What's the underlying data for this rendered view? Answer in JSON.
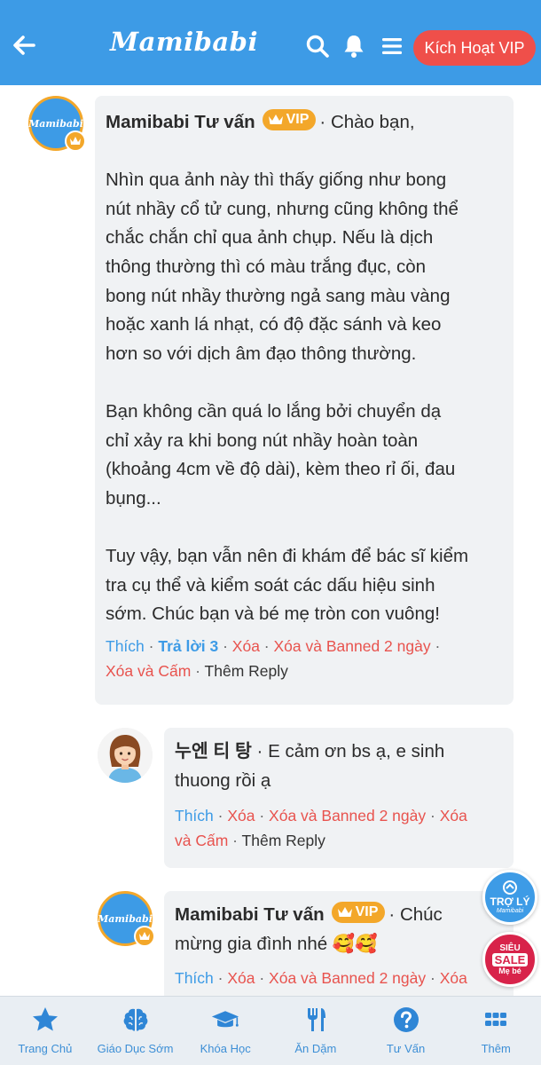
{
  "header": {
    "logo": "Mamibabi",
    "vip_button": "Kích Hoạt VIP",
    "icons": [
      "back-arrow-icon",
      "search-icon",
      "bell-icon",
      "menu-icon"
    ],
    "bg_color": "#3d9be6",
    "vip_color": "#ef4f4a"
  },
  "comments": [
    {
      "author": "Mamibabi Tư vấn",
      "vip_label": "VIP",
      "avatar_text": "Mamibabi",
      "lines": [
        "· Chào bạn,",
        "",
        "Nhìn qua ảnh này thì thấy giống như bong",
        "nút nhầy cổ tử cung, nhưng cũng không thể",
        "chắc chắn chỉ qua ảnh chụp. Nếu là dịch",
        "thông thường thì có màu trắng đục, còn",
        "bong nút nhầy thường ngả sang màu vàng",
        "hoặc xanh lá nhạt, có độ đặc sánh và keo",
        "hơn so với dịch âm đạo thông thường.",
        "",
        "Bạn không cần quá lo lắng bởi chuyển dạ",
        "chỉ xảy ra khi bong nút nhầy hoàn toàn",
        "(khoảng 4cm về độ dài), kèm theo rỉ ối, đau",
        "bụng...",
        "",
        "Tuy vậy, bạn vẫn nên đi khám để bác sĩ kiểm",
        "tra cụ thể và kiểm soát các dấu hiệu sinh",
        "sớm. Chúc bạn và bé mẹ tròn con vuông!"
      ],
      "actions": {
        "like": "Thích",
        "reply": "Trả lời 3",
        "delete": "Xóa",
        "delete_ban": "Xóa và Banned 2 ngày",
        "delete_block": "Xóa và Cấm",
        "more_reply": "Thêm Reply"
      }
    },
    {
      "author": "누엔 티 탕",
      "line1": "· E cảm ơn bs ạ, e sinh",
      "line2": "thuong rồi ạ",
      "actions": {
        "like": "Thích",
        "delete": "Xóa",
        "delete_ban": "Xóa và Banned 2 ngày",
        "delete_block_1": "Xóa",
        "delete_block_2": "và Cấm",
        "more_reply": "Thêm Reply"
      }
    },
    {
      "author": "Mamibabi Tư vấn",
      "vip_label": "VIP",
      "avatar_text": "Mamibabi",
      "line1": "· Chúc",
      "line2": "mừng gia đình nhé 🥰🥰",
      "actions": {
        "like": "Thích",
        "delete": "Xóa",
        "delete_ban": "Xóa và Banned 2 ngày",
        "delete_block": "Xóa"
      }
    }
  ],
  "floating": {
    "assistant_1": "TRỢ LÝ",
    "assistant_2": "Mamibabi",
    "sale_1": "SIÊU",
    "sale_2": "SALE",
    "sale_3": "Mẹ bé"
  },
  "bottom_nav": [
    {
      "label": "Trang Chủ",
      "icon": "star-icon"
    },
    {
      "label": "Giáo Dục Sớm",
      "icon": "brain-icon"
    },
    {
      "label": "Khóa Học",
      "icon": "graduation-cap-icon"
    },
    {
      "label": "Ăn Dặm",
      "icon": "utensils-icon"
    },
    {
      "label": "Tư Vấn",
      "icon": "question-icon"
    },
    {
      "label": "Thêm",
      "icon": "grid-icon"
    }
  ]
}
